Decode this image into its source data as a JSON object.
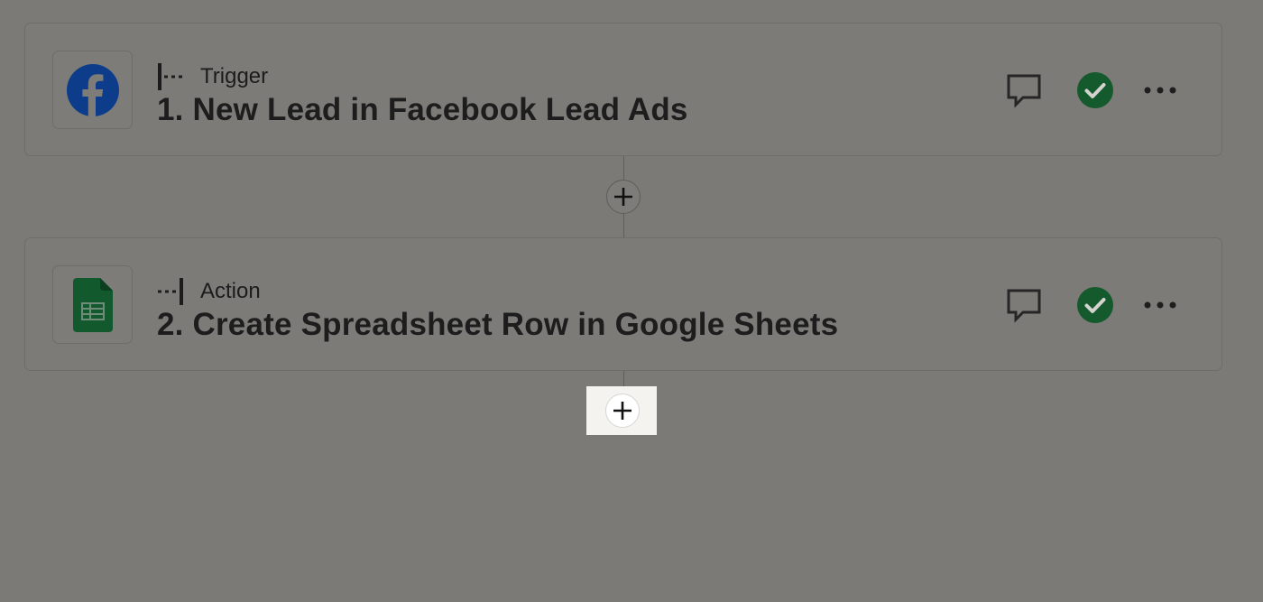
{
  "steps": [
    {
      "kind": "Trigger",
      "title": "1. New Lead in Facebook Lead Ads",
      "app_icon": "facebook-logo-icon",
      "status": "complete"
    },
    {
      "kind": "Action",
      "title": "2. Create Spreadsheet Row in Google Sheets",
      "app_icon": "google-sheets-icon",
      "status": "complete"
    }
  ],
  "icons": {
    "comment": "comment-icon",
    "status": "check-circle-icon",
    "more": "more-horizontal-icon",
    "add": "plus-icon"
  },
  "colors": {
    "facebook_blue": "#0d3d8a",
    "sheets_green": "#125a2d",
    "status_green": "#145a2c",
    "highlight": "#f4f3ef"
  }
}
